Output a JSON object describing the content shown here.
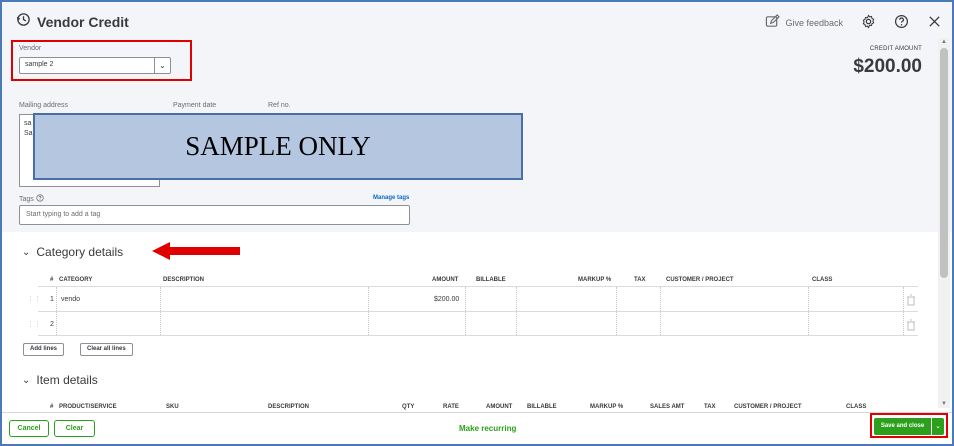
{
  "window": {
    "title": "Vendor Credit",
    "give_feedback": "Give feedback"
  },
  "vendor": {
    "label": "Vendor",
    "value": "sample 2"
  },
  "credit": {
    "label": "CREDIT AMOUNT",
    "amount": "$200.00"
  },
  "fields": {
    "mailing_address_label": "Mailing address",
    "mailing_address_line1": "sa",
    "mailing_address_line2": "Sa",
    "payment_date_label": "Payment date",
    "ref_no_label": "Ref no.",
    "tags_label": "Tags",
    "tags_placeholder": "Start typing to add a tag",
    "manage_tags": "Manage tags"
  },
  "watermark": "SAMPLE ONLY",
  "category_details": {
    "title": "Category details",
    "columns": {
      "num": "#",
      "category": "CATEGORY",
      "description": "DESCRIPTION",
      "amount": "AMOUNT",
      "billable": "BILLABLE",
      "markup": "MARKUP %",
      "tax": "TAX",
      "customer": "CUSTOMER / PROJECT",
      "class": "CLASS"
    },
    "rows": [
      {
        "num": "1",
        "category": "vendo",
        "amount": "$200.00"
      },
      {
        "num": "2",
        "category": "",
        "amount": ""
      }
    ],
    "add_lines": "Add lines",
    "clear_all_lines": "Clear all lines"
  },
  "item_details": {
    "title": "Item details",
    "columns": {
      "num": "#",
      "product": "PRODUCT/SERVICE",
      "sku": "SKU",
      "description": "DESCRIPTION",
      "qty": "QTY",
      "rate": "RATE",
      "amount": "AMOUNT",
      "billable": "BILLABLE",
      "markup": "MARKUP %",
      "sales_amt": "SALES AMT",
      "tax": "TAX",
      "customer": "CUSTOMER / PROJECT",
      "class": "CLASS"
    }
  },
  "footer": {
    "cancel": "Cancel",
    "clear": "Clear",
    "make_recurring": "Make recurring",
    "save_and_close": "Save and close"
  },
  "colors": {
    "brand_green": "#2ca01c",
    "highlight_red": "#e00000",
    "link_blue": "#0b6ac9"
  }
}
